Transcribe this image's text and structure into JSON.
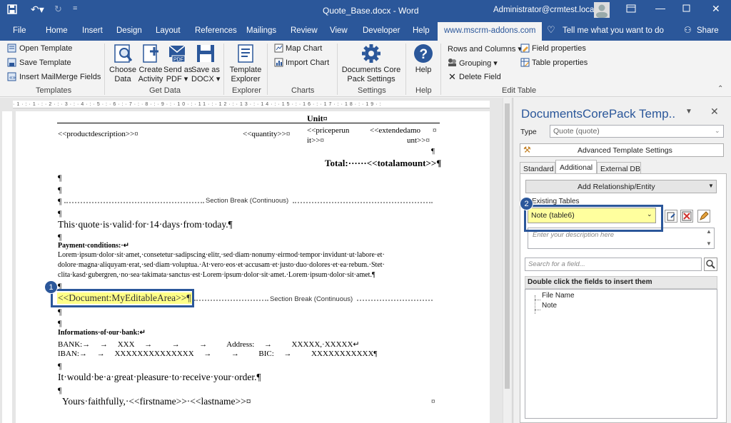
{
  "titlebar": {
    "document_title": "Quote_Base.docx - Word",
    "user": "Administrator@crmtest.local"
  },
  "menu": {
    "tabs": [
      "File",
      "Home",
      "Insert",
      "Design",
      "Layout",
      "References",
      "Mailings",
      "Review",
      "View",
      "Developer",
      "Help",
      "www.mscrm-addons.com"
    ],
    "tell_me": "Tell me what you want to do",
    "share": "Share"
  },
  "ribbon": {
    "templates": {
      "open": "Open Template",
      "save": "Save Template",
      "insert_mm": "Insert MailMerge Fields",
      "label": "Templates"
    },
    "getdata": {
      "choose": "Choose\nData",
      "create": "Create\nActivity",
      "send": "Send as\nPDF ▾",
      "save": "Save as\nDOCX ▾",
      "label": "Get Data"
    },
    "explorer": {
      "tpl": "Template\nExplorer",
      "label": "Explorer"
    },
    "charts": {
      "map": "Map Chart",
      "import": "Import Chart",
      "label": "Charts"
    },
    "settings": {
      "core": "Documents Core\nPack Settings",
      "label": "Settings"
    },
    "help": {
      "help": "Help",
      "label": "Help"
    },
    "edit": {
      "rows": "Rows and Columns ▾",
      "grouping": "Grouping ▾",
      "delete": "Delete Field",
      "field_props": "Field properties",
      "table_props": "Table properties",
      "label": "Edit Table"
    }
  },
  "doc": {
    "unit": "Unit¤",
    "productdescription": "<<productdescription>>¤",
    "quantity": "<<quantity>>¤",
    "priceperun1": "<<priceperun",
    "priceperun2": "it>>¤",
    "extended1": "<<extendedamo",
    "extended2": "unt>>¤",
    "cellend": "¤",
    "pil": "¶",
    "total": "Total:······<<totalamount>>¶",
    "section_break": "Section Break (Continuous)",
    "valid": "This·quote·is·valid·for·14·days·from·today.¶",
    "payment": "Payment·conditions:·↵",
    "lorem1": "Lorem·ipsum·dolor·sit·amet,·consetetur·sadipscing·elitr,·sed·diam·nonumy·eirmod·tempor·invidunt·ut·labore·et·",
    "lorem2": "dolore·magna·aliquyam·erat,·sed·diam·voluptua.·At·vero·eos·et·accusam·et·justo·duo·dolores·et·ea·rebum.·Stet·",
    "lorem3": "clita·kasd·gubergren,·no·sea·takimata·sanctus·est·Lorem·ipsum·dolor·sit·amet.·Lorem·ipsum·dolor·sit·amet.¶",
    "editable": "<<Document:MyEditableArea>>",
    "bank_title": "Informations·of·our·bank:↵",
    "bank_row1": "BANK:→     →     XXX     →          →          →          Address:     →          XXXXX,·XXXXX↵",
    "iban_row": "IBAN:→     →     XXXXXXXXXXXXXX     →          →          BIC:     →          XXXXXXXXXXX¶",
    "pleasure": "It·would·be·a·great·pleasure·to·receive·your·order.¶",
    "faithfully": "Yours·faithfully,·<<firstname>>·<<lastname>>¤"
  },
  "pane": {
    "title": "DocumentsCorePack Temp..",
    "type_label": "Type",
    "type_value": "Quote (quote)",
    "advanced": "Advanced Template Settings",
    "tabs": [
      "Standard",
      "Additional",
      "External DB"
    ],
    "add_rel": "Add Relationship/Entity",
    "existing": "Existing  Tables",
    "selected_table": "Note (table6)",
    "desc_placeholder": "Enter your description here",
    "search_placeholder": "Search for a field...",
    "fields_header": "Double click the fields to insert them",
    "fields": [
      "File Name",
      "Note"
    ]
  },
  "badges": {
    "one": "1",
    "two": "2"
  },
  "colors": {
    "word_blue": "#2b579a",
    "highlight": "#ffff88"
  }
}
